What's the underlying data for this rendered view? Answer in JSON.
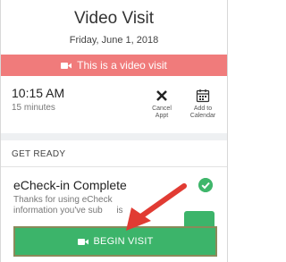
{
  "header": {
    "title": "Video Visit",
    "date": "Friday, June 1, 2018"
  },
  "banner": {
    "text": "This is a video visit",
    "icon": "video-camera-icon",
    "color": "#f07b7b"
  },
  "appointment": {
    "time": "10:15 AM",
    "duration": "15 minutes",
    "actions": [
      {
        "label_line1": "Cancel",
        "label_line2": "Appt",
        "icon": "close-icon"
      },
      {
        "label_line1": "Add to",
        "label_line2": "Calendar",
        "icon": "calendar-icon"
      }
    ]
  },
  "get_ready": {
    "section_label": "GET READY",
    "item": {
      "title": "eCheck-in Complete",
      "description_line1": "Thanks for using eCheck",
      "description_line2": "information you've sub",
      "description_line3": "is",
      "status": "complete",
      "status_color": "#3fb66b"
    }
  },
  "cta": {
    "label": "BEGIN VISIT",
    "icon": "video-camera-icon",
    "color": "#3cb46a"
  },
  "annotation": {
    "arrow_color": "#e13b33",
    "icon": "red-arrow-icon"
  }
}
